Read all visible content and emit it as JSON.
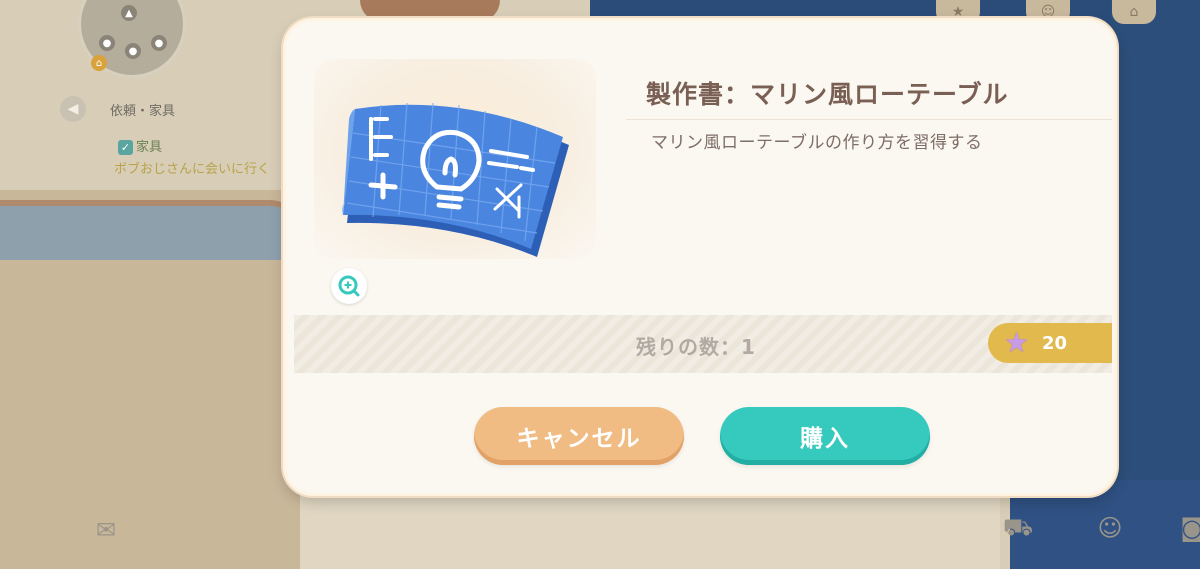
{
  "hud": {
    "quest_title": "依頼・家具",
    "quest_task": "家具",
    "quest_subtitle": "ボブおじさんに会いに行く"
  },
  "dialog": {
    "item_name": "製作書：マリン風ローテーブル",
    "item_description": "マリン風ローテーブルの作り方を習得する",
    "stock_label": "残りの数：1",
    "price": "20",
    "currency_icon": "purple-star",
    "buttons": {
      "cancel": "キャンセル",
      "buy": "購入"
    }
  },
  "colors": {
    "cancel_button": "#f0bc84",
    "buy_button": "#36c9bd",
    "price_tag": "#e2b94c",
    "title_text": "#7a6054"
  }
}
